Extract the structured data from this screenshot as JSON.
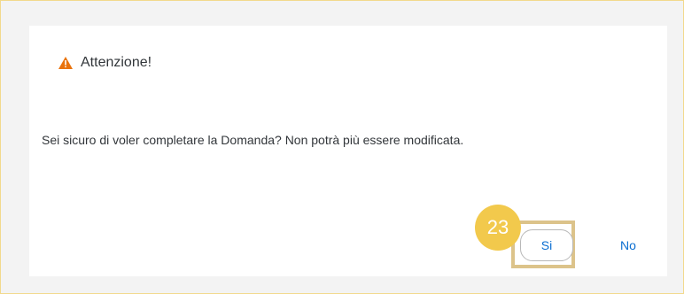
{
  "dialog": {
    "title": "Attenzione!",
    "title_icon": "warning-icon",
    "message": "Sei sicuro di voler completare la Domanda? Non potrà più essere modificata.",
    "buttons": {
      "yes_label": "Si",
      "no_label": "No"
    }
  },
  "tutorial": {
    "step_number": "23"
  },
  "colors": {
    "accent": "#0a6ed1",
    "warning": "#e9730c",
    "step_badge": "#f2c94c",
    "highlight_border": "#dcc38a"
  }
}
